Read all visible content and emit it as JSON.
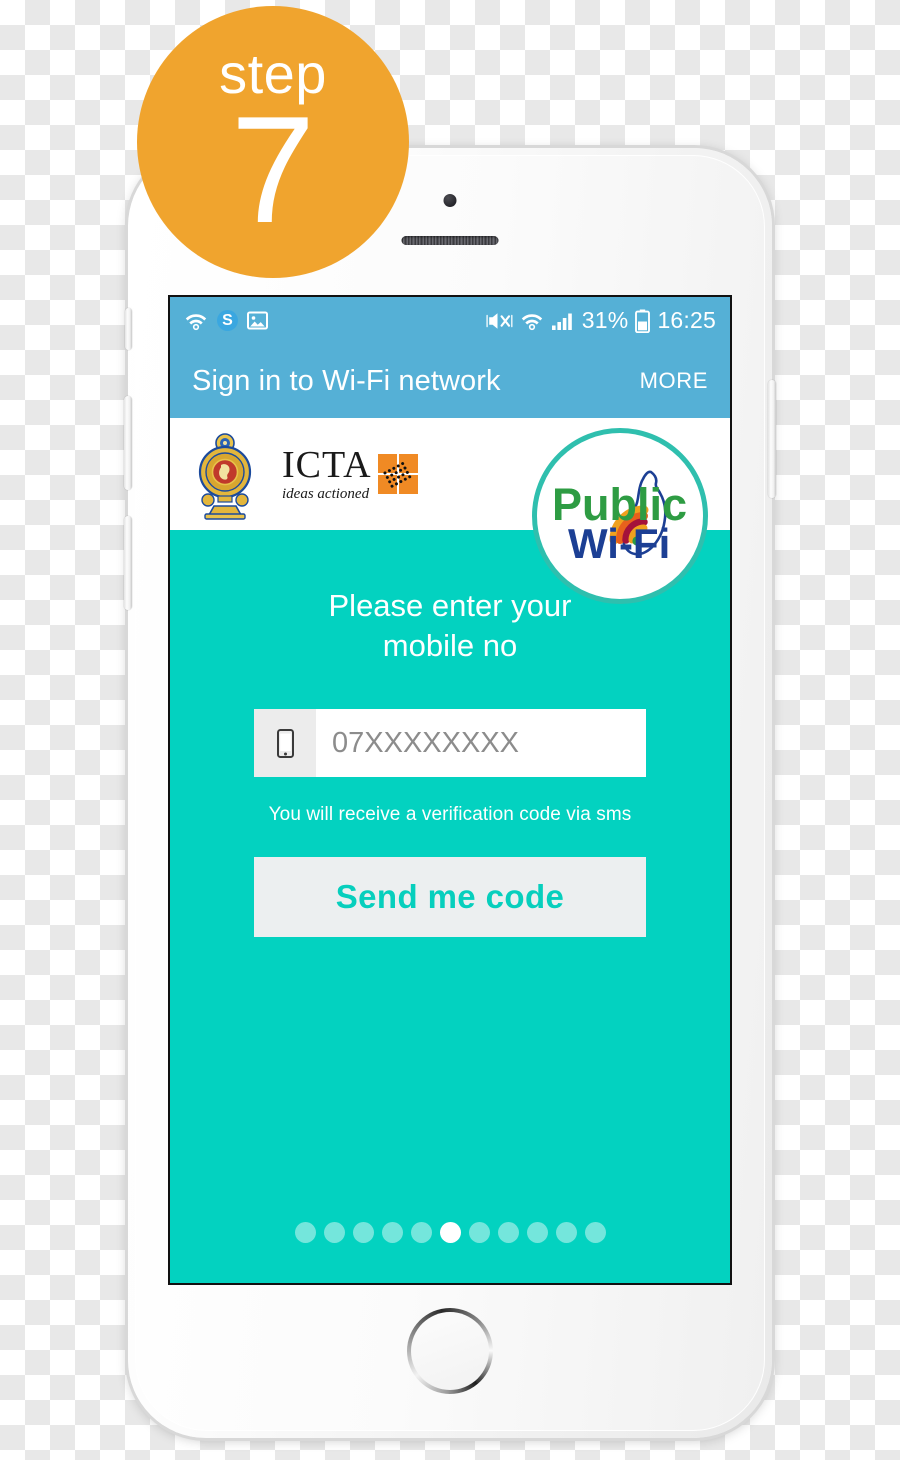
{
  "badge": {
    "word": "step",
    "number": "7",
    "color": "#f0a42e"
  },
  "phone": {
    "hardware": {
      "camera": "camera-dot",
      "earpiece": "earpiece-speaker",
      "home_button": "home-button",
      "mute_switch": "mute-switch",
      "volume_up": "volume-up-button",
      "volume_down": "volume-down-button",
      "power": "power-button"
    }
  },
  "status_bar": {
    "background": "#55b0d6",
    "left_icons": [
      "wifi-icon",
      "skype-icon",
      "image-icon"
    ],
    "right_icons": [
      "mute-icon",
      "wifi-icon",
      "signal-icon",
      "battery-icon"
    ],
    "battery_percent": "31%",
    "time": "16:25"
  },
  "app_bar": {
    "title": "Sign in to Wi-Fi network",
    "more_label": "MORE",
    "background": "#55b0d6"
  },
  "logo_band": {
    "emblem_name": "sri-lanka-government-emblem",
    "icta_word": "ICTA",
    "icta_tagline": "ideas actioned",
    "icta_mark_name": "icta-orange-mark",
    "public_wifi": {
      "line1": "Public",
      "line2": "Wi-Fi",
      "line1_color": "#2e9c43",
      "line2_color": "#1c3f94",
      "ring_color": "#2fbfae"
    }
  },
  "main": {
    "background": "#03d2c0",
    "prompt": "Please enter your\nmobile no",
    "input": {
      "icon": "mobile-phone-icon",
      "placeholder": "07XXXXXXXX",
      "value": ""
    },
    "helper_text": "You will receive a verification code via sms",
    "button_label": "Send me code",
    "button_text_color": "#07cfbd",
    "button_background": "#eceff0"
  },
  "pager": {
    "total": 11,
    "active_index": 5
  }
}
